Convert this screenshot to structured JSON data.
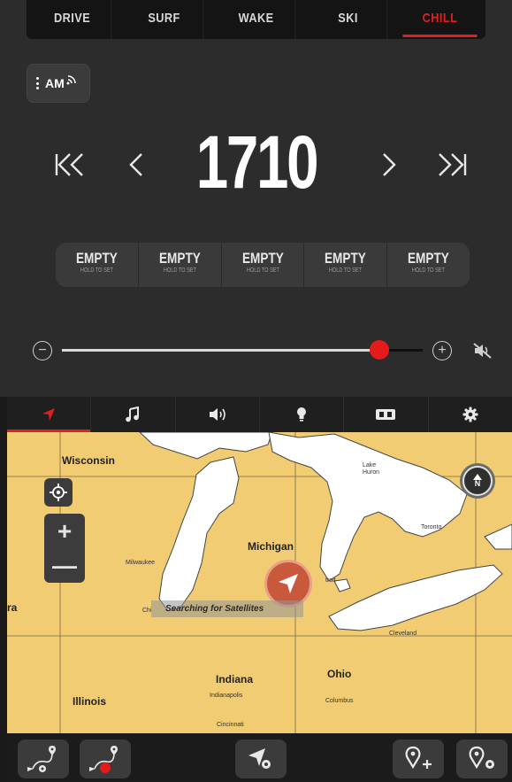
{
  "mode_tabs": [
    {
      "label": "DRIVE",
      "active": false
    },
    {
      "label": "SURF",
      "active": false
    },
    {
      "label": "WAKE",
      "active": false
    },
    {
      "label": "SKI",
      "active": false
    },
    {
      "label": "CHILL",
      "active": true
    }
  ],
  "radio": {
    "source_icon": "menu-dots-icon",
    "band": "AM",
    "frequency": "1710",
    "presets": [
      {
        "label": "EMPTY",
        "sub": "HOLD TO SET"
      },
      {
        "label": "EMPTY",
        "sub": "HOLD TO SET"
      },
      {
        "label": "EMPTY",
        "sub": "HOLD TO SET"
      },
      {
        "label": "EMPTY",
        "sub": "HOLD TO SET"
      },
      {
        "label": "EMPTY",
        "sub": "HOLD TO SET"
      }
    ],
    "volume_level": 0.88,
    "volume_minus": "−",
    "volume_plus": "+"
  },
  "nav": {
    "items": [
      {
        "icon": "navigation-arrow-icon",
        "active": true
      },
      {
        "icon": "music-note-icon",
        "active": false
      },
      {
        "icon": "speaker-icon",
        "active": false
      },
      {
        "icon": "light-bulb-icon",
        "active": false
      },
      {
        "icon": "battery-icon",
        "active": false
      },
      {
        "icon": "gear-icon",
        "active": false
      }
    ]
  },
  "map": {
    "states": {
      "wisconsin": "Wisconsin",
      "michigan": "Michigan",
      "indiana": "Indiana",
      "ohio": "Ohio",
      "illinois": "Illinois",
      "partial_left": "ra"
    },
    "cities": {
      "milwaukee": "Milwaukee",
      "chicago": "Chi",
      "detroit": "troit",
      "cleveland": "Cleveland",
      "indianapolis": "Indianapolis",
      "columbus": "Columbus",
      "cincinnati": "Cincinnati",
      "toronto": "Toronto"
    },
    "lake_huron": "Lake\nHuron",
    "zoom_in": "+",
    "zoom_out": "—",
    "compass_letter": "N",
    "status": "Searching for Satellites"
  },
  "colors": {
    "accent": "#e02020",
    "map_land": "#f1cc72",
    "map_water": "#ffffff",
    "vessel": "#c8593a"
  }
}
